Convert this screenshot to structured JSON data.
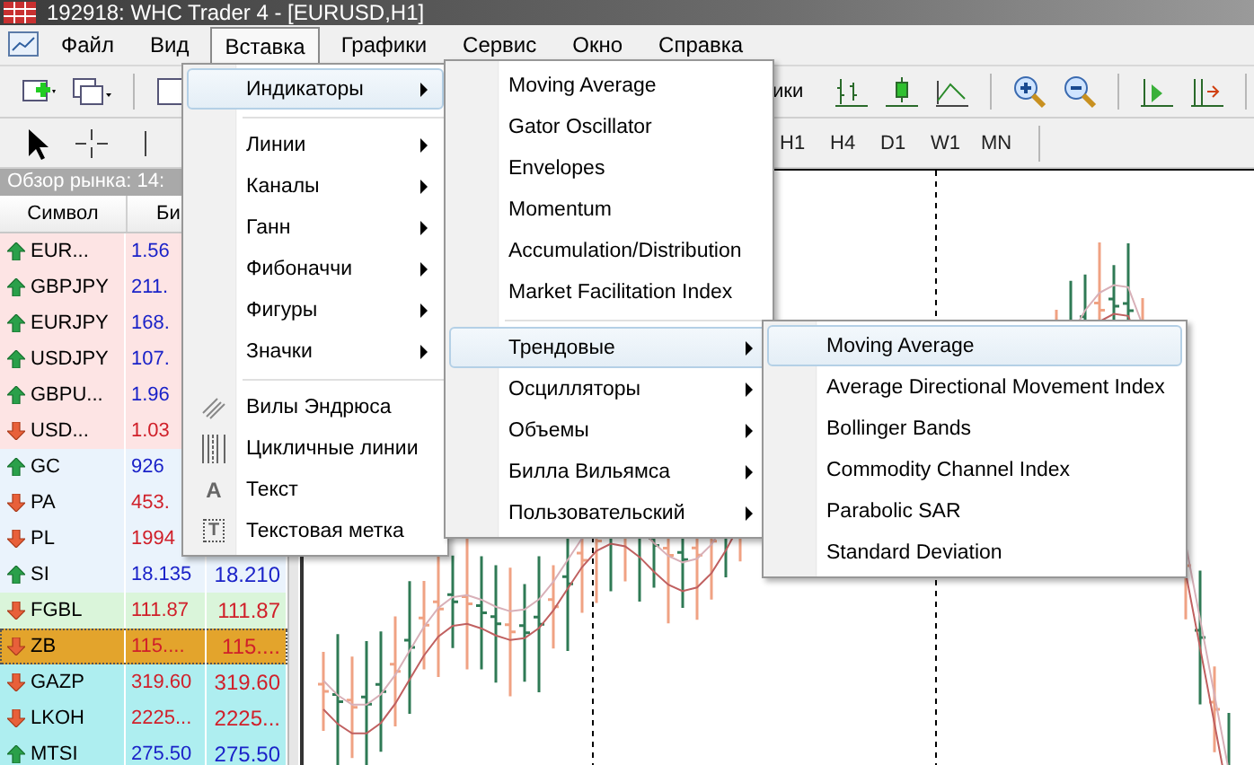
{
  "window": {
    "title": "192918: WHC Trader 4 - [EURUSD,H1]"
  },
  "menu_bar": [
    {
      "label": "Файл",
      "selected": false
    },
    {
      "label": "Вид",
      "selected": false
    },
    {
      "label": "Вставка",
      "selected": true
    },
    {
      "label": "Графики",
      "selected": false
    },
    {
      "label": "Сервис",
      "selected": false
    },
    {
      "label": "Окно",
      "selected": false
    },
    {
      "label": "Справка",
      "selected": false
    }
  ],
  "toolbar": {
    "button_label": "ики",
    "timeframes": [
      "H1",
      "H4",
      "D1",
      "W1",
      "MN"
    ]
  },
  "market_watch": {
    "title": "Обзор рынка: 14:",
    "columns": [
      "Символ",
      "Би"
    ],
    "rows": [
      {
        "symbol": "EUR...",
        "bid": "1.56",
        "rising": true,
        "color": "#fde4e4",
        "selected": false
      },
      {
        "symbol": "GBPJPY",
        "bid": "211.",
        "rising": true,
        "color": "#fde4e4",
        "selected": false
      },
      {
        "symbol": "EURJPY",
        "bid": "168.",
        "rising": true,
        "color": "#fde4e4",
        "selected": false
      },
      {
        "symbol": "USDJPY",
        "bid": "107.",
        "rising": true,
        "color": "#fde4e4",
        "selected": false
      },
      {
        "symbol": "GBPU...",
        "bid": "1.96",
        "rising": true,
        "color": "#fde4e4",
        "selected": false
      },
      {
        "symbol": "USD...",
        "bid": "1.03",
        "rising": false,
        "color": "#fde4e4",
        "selected": false
      },
      {
        "symbol": "GC",
        "bid": "926",
        "rising": true,
        "color": "#eaf3fc",
        "selected": false
      },
      {
        "symbol": "PA",
        "bid": "453.",
        "rising": false,
        "color": "#eaf3fc",
        "selected": false
      },
      {
        "symbol": "PL",
        "bid": "1994",
        "rising": false,
        "color": "#eaf3fc",
        "selected": false
      },
      {
        "symbol": "SI",
        "bid": "18.135",
        "ask": "18.210",
        "rising": true,
        "color": "#eaf3fc",
        "selected": false
      },
      {
        "symbol": "FGBL",
        "bid": "111.87",
        "ask": "111.87",
        "rising": false,
        "color": "#daf5da",
        "selected": false
      },
      {
        "symbol": "ZB",
        "bid": "115....",
        "ask": "115....",
        "rising": false,
        "color": "#e3a42c",
        "selected": true
      },
      {
        "symbol": "GAZP",
        "bid": "319.60",
        "ask": "319.60",
        "rising": false,
        "color": "#aeeef0",
        "selected": false
      },
      {
        "symbol": "LKOH",
        "bid": "2225...",
        "ask": "2225...",
        "rising": false,
        "color": "#aeeef0",
        "selected": false
      },
      {
        "symbol": "MTSI",
        "bid": "275.50",
        "ask": "275.50",
        "rising": true,
        "color": "#aeeef0",
        "selected": false
      }
    ]
  },
  "insert_menu": {
    "items": [
      {
        "kind": "item",
        "label": "Индикаторы",
        "has_submenu": true,
        "selected": true
      },
      {
        "kind": "separator"
      },
      {
        "kind": "item",
        "label": "Линии",
        "has_submenu": true,
        "selected": false
      },
      {
        "kind": "item",
        "label": "Каналы",
        "has_submenu": true,
        "selected": false
      },
      {
        "kind": "item",
        "label": "Ганн",
        "has_submenu": true,
        "selected": false
      },
      {
        "kind": "item",
        "label": "Фибоначчи",
        "has_submenu": true,
        "selected": false
      },
      {
        "kind": "item",
        "label": "Фигуры",
        "has_submenu": true,
        "selected": false
      },
      {
        "kind": "item",
        "label": "Значки",
        "has_submenu": true,
        "selected": false
      },
      {
        "kind": "separator"
      },
      {
        "kind": "pitchfork",
        "label": "Вилы Эндрюса",
        "has_submenu": false,
        "selected": false
      },
      {
        "kind": "cycles",
        "label": "Цикличные линии",
        "has_submenu": false,
        "selected": false
      },
      {
        "kind": "letter",
        "glyph": "A",
        "label": "Текст",
        "has_submenu": false,
        "selected": false
      },
      {
        "kind": "tag",
        "glyph": "T",
        "label": "Текстовая метка",
        "has_submenu": false,
        "selected": false
      }
    ]
  },
  "indicators_menu": {
    "items": [
      {
        "kind": "item",
        "label": "Moving Average",
        "has_submenu": false,
        "selected": false
      },
      {
        "kind": "item",
        "label": "Gator Oscillator",
        "has_submenu": false,
        "selected": false
      },
      {
        "kind": "item",
        "label": "Envelopes",
        "has_submenu": false,
        "selected": false
      },
      {
        "kind": "item",
        "label": "Momentum",
        "has_submenu": false,
        "selected": false
      },
      {
        "kind": "item",
        "label": "Accumulation/Distribution",
        "has_submenu": false,
        "selected": false
      },
      {
        "kind": "item",
        "label": "Market Facilitation Index",
        "has_submenu": false,
        "selected": false
      },
      {
        "kind": "separator"
      },
      {
        "kind": "item",
        "label": "Трендовые",
        "has_submenu": true,
        "selected": true
      },
      {
        "kind": "item",
        "label": "Осцилляторы",
        "has_submenu": true,
        "selected": false
      },
      {
        "kind": "item",
        "label": "Объемы",
        "has_submenu": true,
        "selected": false
      },
      {
        "kind": "item",
        "label": "Билла Вильямса",
        "has_submenu": true,
        "selected": false
      },
      {
        "kind": "item",
        "label": "Пользовательский",
        "has_submenu": true,
        "selected": false
      }
    ]
  },
  "trend_menu": {
    "items": [
      {
        "kind": "item",
        "label": "Moving Average",
        "has_submenu": false,
        "selected": true
      },
      {
        "kind": "item",
        "label": "Average Directional Movement Index",
        "has_submenu": false,
        "selected": false
      },
      {
        "kind": "item",
        "label": "Bollinger Bands",
        "has_submenu": false,
        "selected": false
      },
      {
        "kind": "item",
        "label": "Commodity Channel Index",
        "has_submenu": false,
        "selected": false
      },
      {
        "kind": "item",
        "label": "Parabolic SAR",
        "has_submenu": false,
        "selected": false
      },
      {
        "kind": "item",
        "label": "Standard Deviation",
        "has_submenu": false,
        "selected": false
      }
    ]
  }
}
